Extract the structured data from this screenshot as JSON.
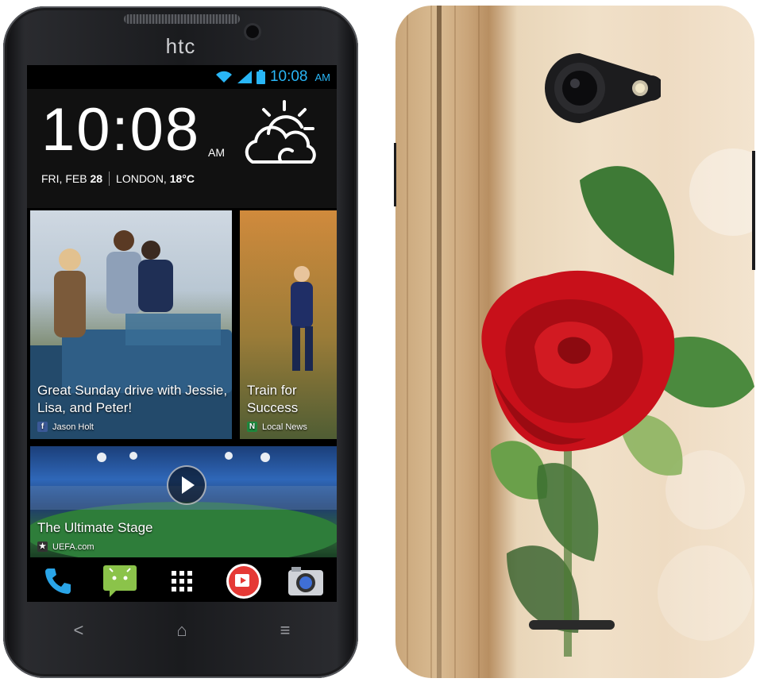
{
  "brand": "htc",
  "status_bar": {
    "time": "10:08",
    "ampm": "AM"
  },
  "clock_widget": {
    "time": "10:08",
    "ampm": "AM",
    "day": "FRI, FEB",
    "date": "28",
    "location": "LONDON,",
    "temperature": "18°C",
    "weather_icon": "partly-cloudy-icon"
  },
  "feed": [
    {
      "caption": "Great Sunday drive with Jessie, Lisa, and Peter!",
      "source": "Jason Holt",
      "source_icon": "facebook-icon"
    },
    {
      "caption": "Train for Success",
      "source": "Local News",
      "source_icon": "news-icon"
    },
    {
      "caption": "The Ultimate Stage",
      "source": "UEFA.com",
      "source_icon": "uefa-icon"
    }
  ],
  "dock": [
    "phone-icon",
    "messages-icon",
    "app-drawer-icon",
    "video-icon",
    "camera-icon"
  ],
  "nav": {
    "back": "<",
    "home": "⌂",
    "menu": "≡"
  },
  "colors": {
    "status_blue": "#29b6f6",
    "rose_red": "#c8101a"
  }
}
